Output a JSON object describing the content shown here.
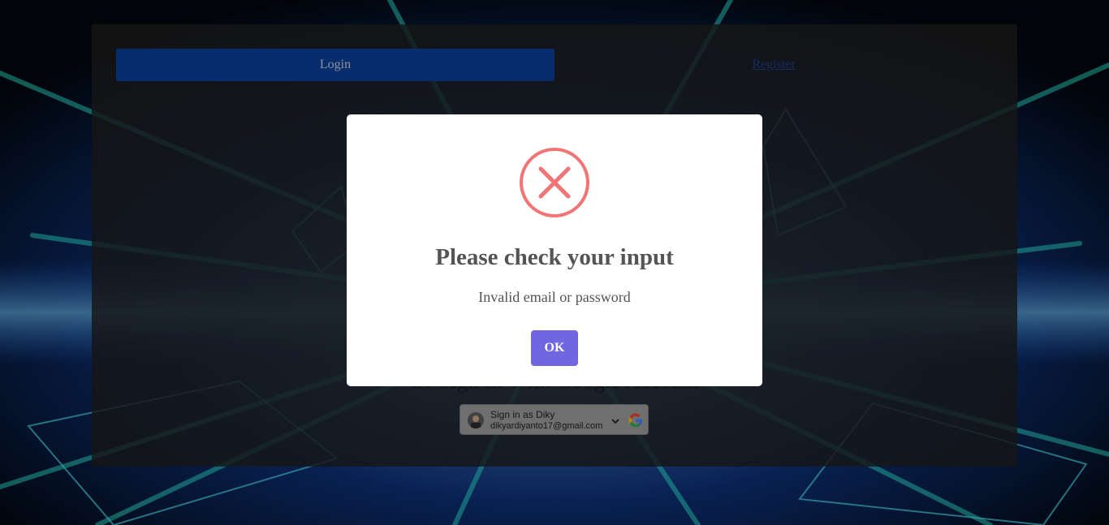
{
  "tabs": {
    "login_label": "Login",
    "register_label": "Register"
  },
  "google_signin": {
    "heading": "Or Sign In With Google Account",
    "account_name": "Sign in as Diky",
    "account_email": "dikyardiyanto17@gmail.com",
    "icons": [
      "avatar",
      "chevron-down-icon",
      "google-logo"
    ]
  },
  "alert": {
    "icon": "error-x-icon",
    "title": "Please check your input",
    "message": "Invalid email or password",
    "ok_label": "OK"
  },
  "colors": {
    "login_tab": "#0a3f9a",
    "register_link": "#1c3d88",
    "error_icon": "#f27474",
    "ok_button": "#7066e0",
    "modal_text": "#545454"
  }
}
